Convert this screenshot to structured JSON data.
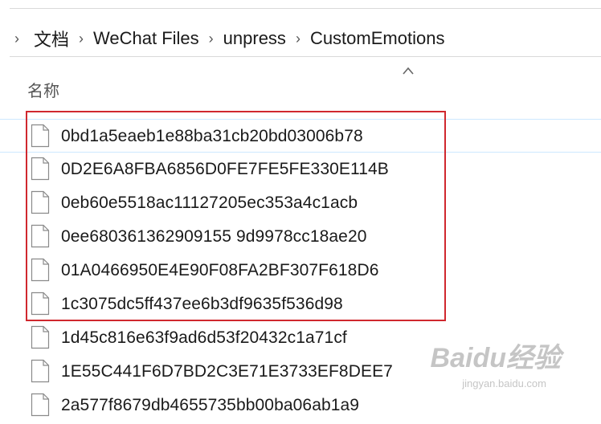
{
  "breadcrumb": [
    "文档",
    "WeChat Files",
    "unpress",
    "CustomEmotions"
  ],
  "column_header": "名称",
  "files": [
    "0bd1a5eaeb1e88ba31cb20bd03006b78",
    "0D2E6A8FBA6856D0FE7FE5FE330E114B",
    "0eb60e5518ac11127205ec353a4c1acb",
    "0ee680361362909155 9d9978cc18ae20",
    "01A0466950E4E90F08FA2BF307F618D6",
    "1c3075dc5ff437ee6b3df9635f536d98",
    "1d45c816e63f9ad6d53f20432c1a71cf",
    "1E55C441F6D7BD2C3E71E3733EF8DEE7",
    "2a577f8679db4655735bb00ba06ab1a9"
  ],
  "watermark": {
    "text": "Baidu经验",
    "sub": "jingyan.baidu.com"
  },
  "colors": {
    "highlight_border": "#d0282e",
    "selection": "#cde8ff"
  }
}
